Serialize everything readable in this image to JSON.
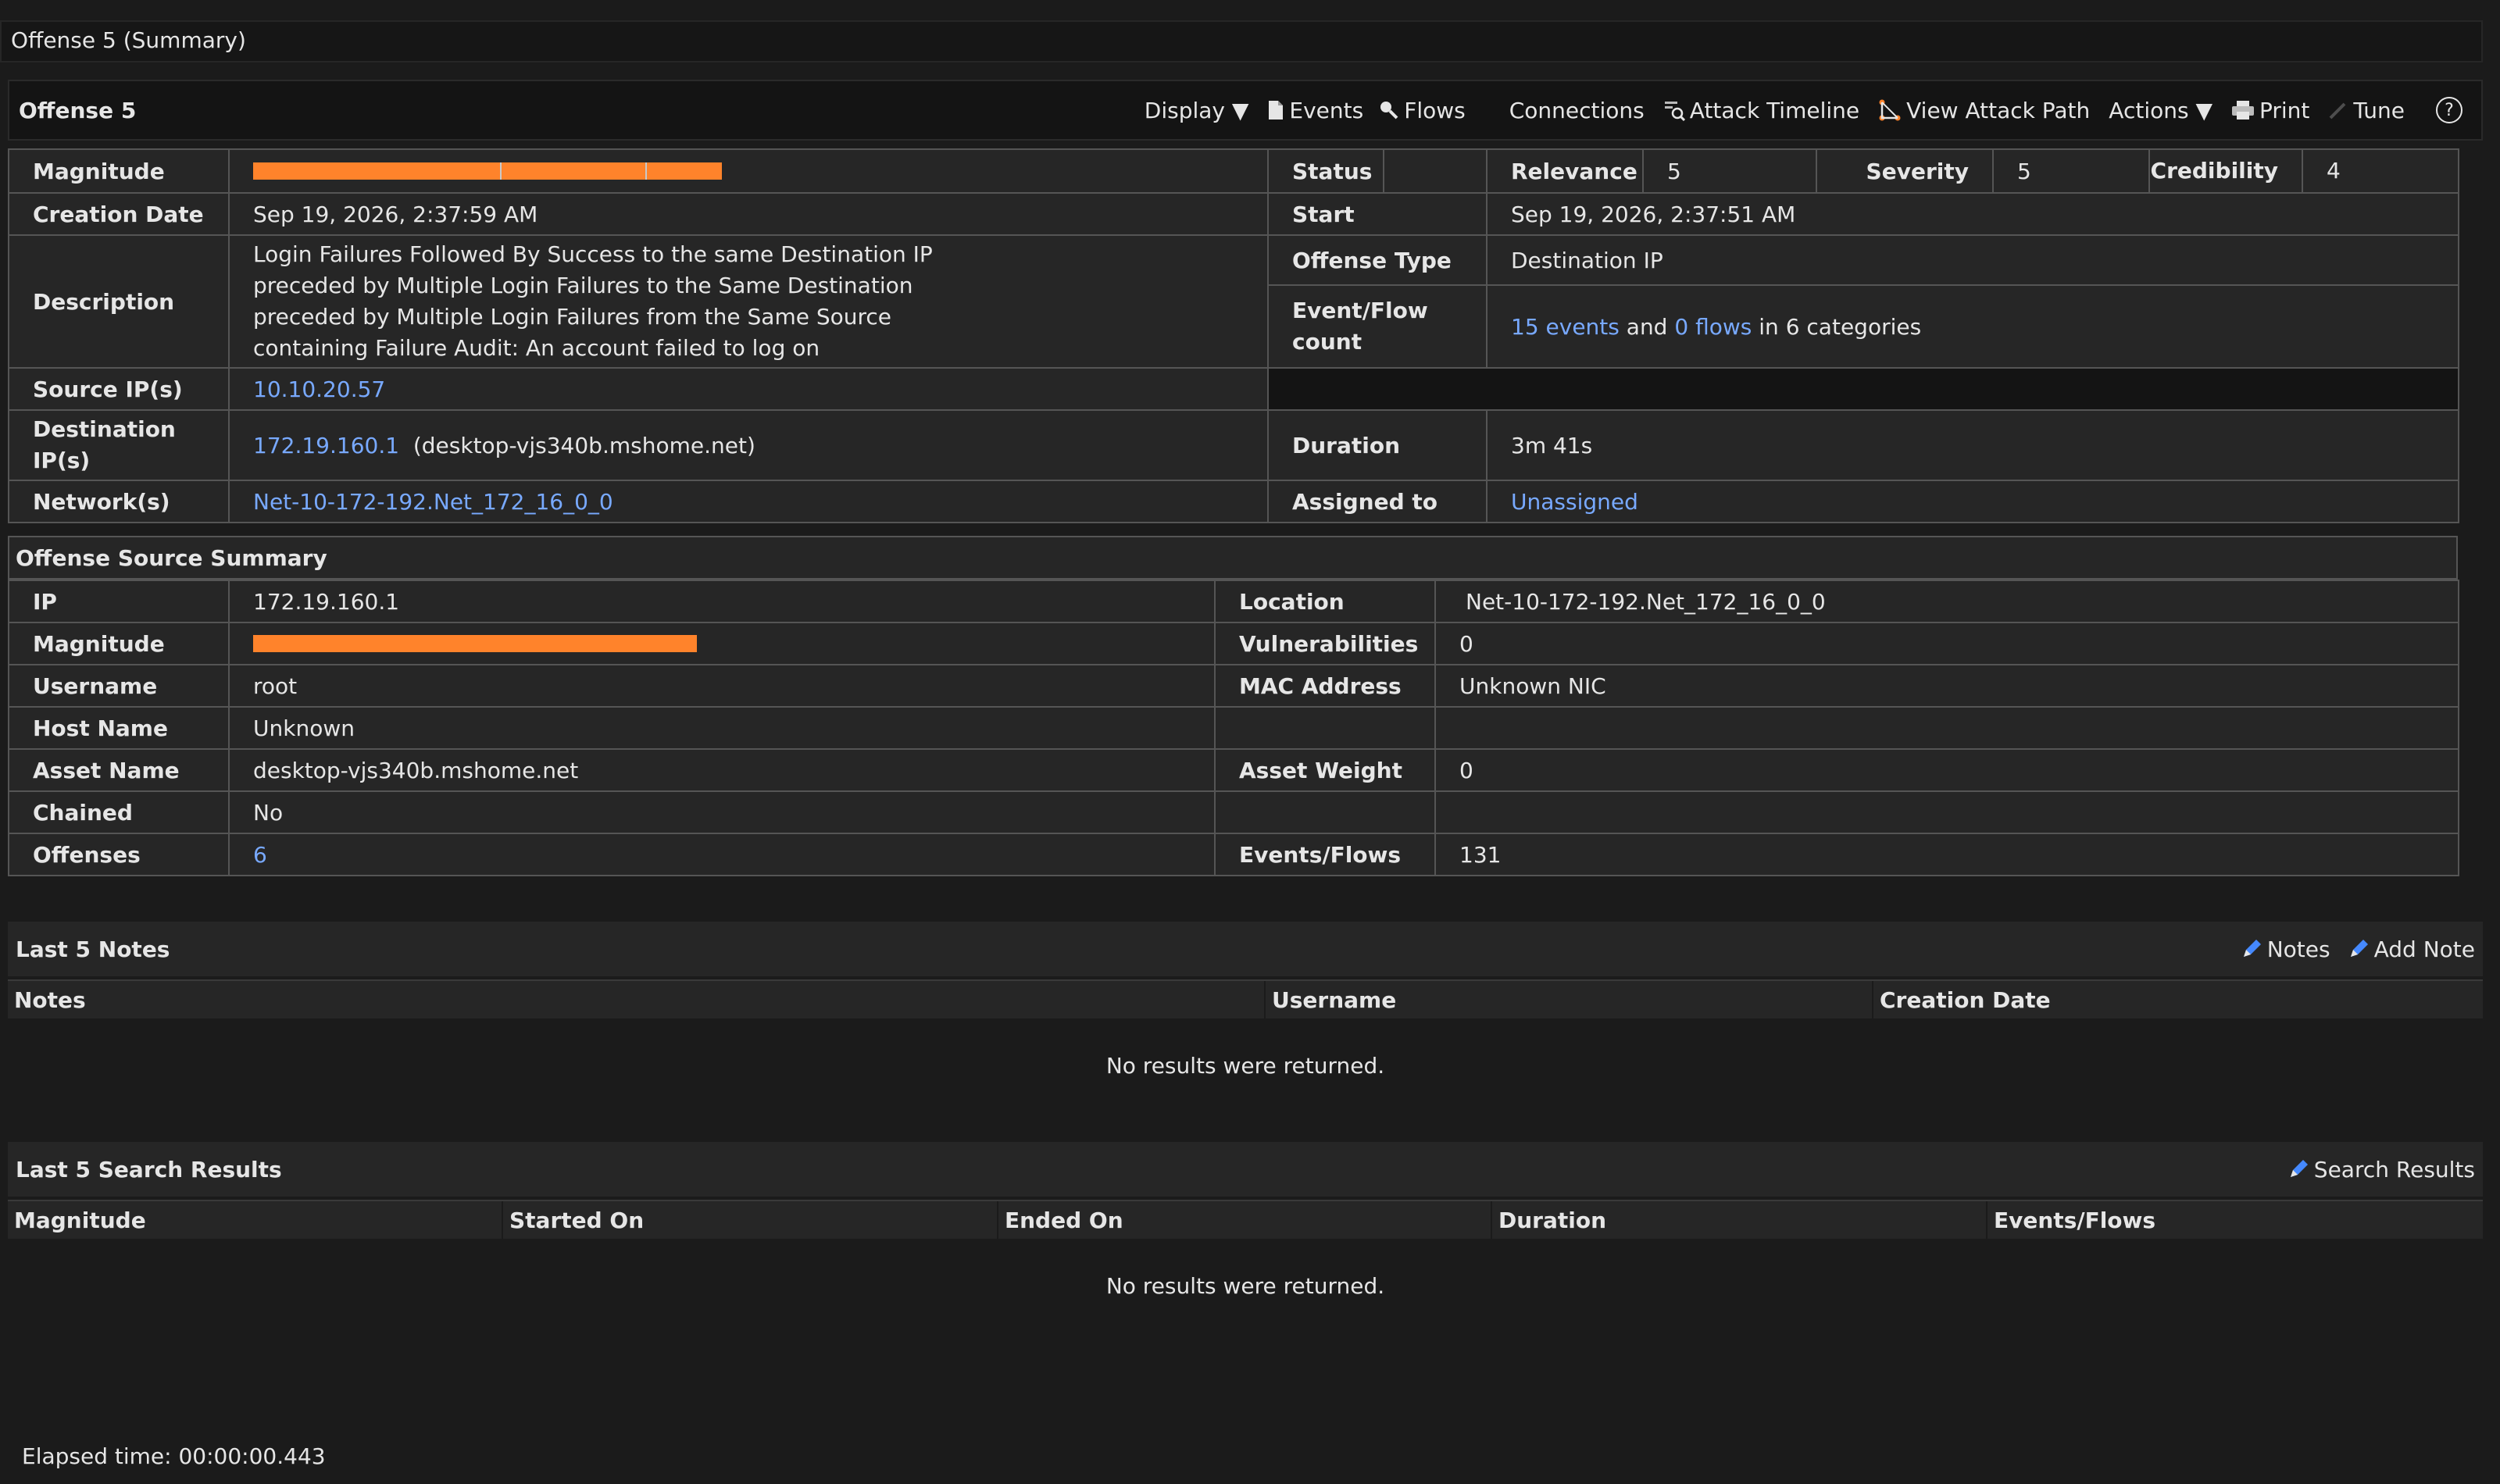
{
  "page_title": "Offense 5 (Summary)",
  "offense_header": {
    "title": "Offense 5",
    "toolbar": {
      "display": "Display ▼",
      "events": "Events",
      "flows": "Flows",
      "connections": "Connections",
      "attack_timeline": "Attack Timeline",
      "view_attack_path": "View Attack Path",
      "actions": "Actions ▼",
      "print": "Print",
      "tune": "Tune"
    },
    "help": "?"
  },
  "summary": {
    "magnitude_label": "Magnitude",
    "magnitude_fraction": 0.46,
    "status_label": "Status",
    "status_value": "",
    "relevance_label": "Relevance",
    "relevance_value": "5",
    "severity_label": "Severity",
    "severity_value": "5",
    "credibility_label": "Credibility",
    "credibility_value": "4",
    "creation_date_label": "Creation Date",
    "creation_date_value": "Sep 19, 2026, 2:37:59 AM",
    "start_label": "Start",
    "start_value": "Sep 19, 2026, 2:37:51 AM",
    "description_label": "Description",
    "description_lines": [
      "Login Failures Followed By Success to the same Destination IP",
      "preceded by Multiple Login Failures to the Same Destination",
      "preceded by Multiple Login Failures from the Same Source",
      "containing Failure Audit: An account failed to log on"
    ],
    "offense_type_label": "Offense Type",
    "offense_type_value": "Destination IP",
    "event_flow_label_1": "Event/Flow",
    "event_flow_label_2": "count",
    "events_link": "15 events",
    "and_text": "and",
    "flows_link": "0 flows",
    "categories_text": "in 6 categories",
    "source_ips_label": "Source IP(s)",
    "source_ips_value": "10.10.20.57",
    "dest_ips_label_1": "Destination",
    "dest_ips_label_2": "IP(s)",
    "dest_ip_link": "172.19.160.1",
    "dest_ip_host": "(desktop-vjs340b.mshome.net)",
    "duration_label": "Duration",
    "duration_value": "3m 41s",
    "networks_label": "Network(s)",
    "networks_value": "Net-10-172-192.Net_172_16_0_0",
    "assigned_label": "Assigned to",
    "assigned_value": "Unassigned"
  },
  "source_summary": {
    "title": "Offense Source Summary",
    "ip_label": "IP",
    "ip_value": "172.19.160.1",
    "location_label": "Location",
    "location_value": "Net-10-172-192.Net_172_16_0_0",
    "magnitude_label": "Magnitude",
    "magnitude_fraction": 0.45,
    "vulnerabilities_label": "Vulnerabilities",
    "vulnerabilities_value": "0",
    "username_label": "Username",
    "username_value": "root",
    "mac_label": "MAC Address",
    "mac_value": "Unknown NIC",
    "hostname_label": "Host Name",
    "hostname_value": "Unknown",
    "asset_name_label": "Asset Name",
    "asset_name_value": "desktop-vjs340b.mshome.net",
    "asset_weight_label": "Asset Weight",
    "asset_weight_value": "0",
    "chained_label": "Chained",
    "chained_value": "No",
    "offenses_label": "Offenses",
    "offenses_value": "6",
    "events_flows_label": "Events/Flows",
    "events_flows_value": "131"
  },
  "notes_section": {
    "title": "Last 5 Notes",
    "notes_btn": "Notes",
    "add_note_btn": "Add Note",
    "columns": [
      "Notes",
      "Username",
      "Creation Date"
    ],
    "empty": "No results were returned."
  },
  "search_section": {
    "title": "Last 5 Search Results",
    "search_btn": "Search Results",
    "columns": [
      "Magnitude",
      "Started On",
      "Ended On",
      "Duration",
      "Events/Flows"
    ],
    "empty": "No results were returned."
  },
  "elapsed": "Elapsed time: 00:00:00.443"
}
